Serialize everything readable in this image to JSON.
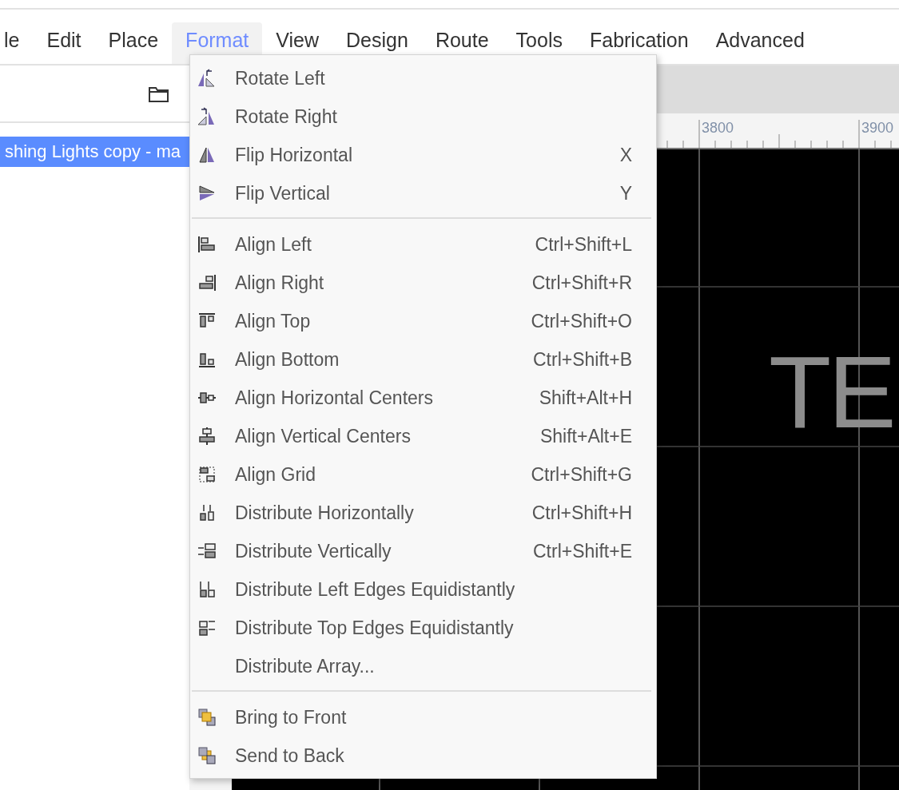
{
  "menubar": [
    {
      "label": "le",
      "selected": false
    },
    {
      "label": "Edit",
      "selected": false
    },
    {
      "label": "Place",
      "selected": false
    },
    {
      "label": "Format",
      "selected": true
    },
    {
      "label": "View",
      "selected": false
    },
    {
      "label": "Design",
      "selected": false
    },
    {
      "label": "Route",
      "selected": false
    },
    {
      "label": "Tools",
      "selected": false
    },
    {
      "label": "Fabrication",
      "selected": false
    },
    {
      "label": "Advanced",
      "selected": false
    }
  ],
  "sidebar": {
    "items": [
      {
        "label": "shing Lights copy - ma",
        "selected": true
      }
    ]
  },
  "ruler": {
    "labels": [
      "3800",
      "3900"
    ]
  },
  "canvas": {
    "text": "TE"
  },
  "format_menu": {
    "groups": [
      [
        {
          "label": "Rotate Left"
        },
        {
          "label": "Rotate Right"
        },
        {
          "label": "Flip Horizontal",
          "shortcut": "X"
        },
        {
          "label": "Flip Vertical",
          "shortcut": "Y"
        }
      ],
      [
        {
          "label": "Align Left",
          "shortcut": "Ctrl+Shift+L"
        },
        {
          "label": "Align Right",
          "shortcut": "Ctrl+Shift+R"
        },
        {
          "label": "Align Top",
          "shortcut": "Ctrl+Shift+O"
        },
        {
          "label": "Align Bottom",
          "shortcut": "Ctrl+Shift+B"
        },
        {
          "label": "Align Horizontal Centers",
          "shortcut": "Shift+Alt+H"
        },
        {
          "label": "Align Vertical Centers",
          "shortcut": "Shift+Alt+E"
        },
        {
          "label": "Align Grid",
          "shortcut": "Ctrl+Shift+G"
        },
        {
          "label": "Distribute Horizontally",
          "shortcut": "Ctrl+Shift+H"
        },
        {
          "label": "Distribute Vertically",
          "shortcut": "Ctrl+Shift+E"
        },
        {
          "label": "Distribute Left Edges Equidistantly"
        },
        {
          "label": "Distribute Top Edges Equidistantly"
        },
        {
          "label": "Distribute Array..."
        }
      ],
      [
        {
          "label": "Bring to Front"
        },
        {
          "label": "Send to Back"
        }
      ]
    ]
  }
}
